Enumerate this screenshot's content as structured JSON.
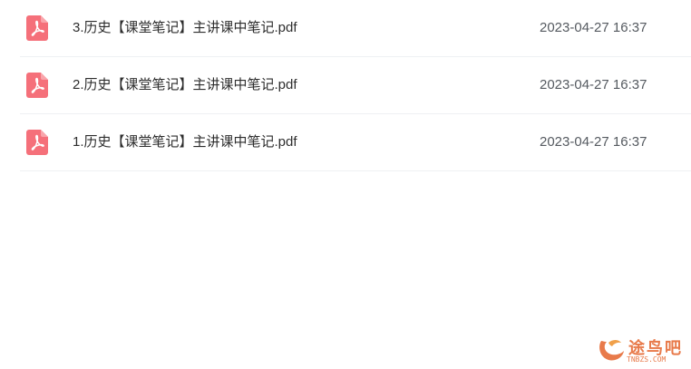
{
  "files": [
    {
      "name": "3.历史【课堂笔记】主讲课中笔记.pdf",
      "date": "2023-04-27 16:37",
      "icon": "pdf-file-icon"
    },
    {
      "name": "2.历史【课堂笔记】主讲课中笔记.pdf",
      "date": "2023-04-27 16:37",
      "icon": "pdf-file-icon"
    },
    {
      "name": "1.历史【课堂笔记】主讲课中笔记.pdf",
      "date": "2023-04-27 16:37",
      "icon": "pdf-file-icon"
    }
  ],
  "watermark": {
    "text": "途鸟吧",
    "sub": "TNBZS.COM"
  },
  "colors": {
    "pdf_icon": "#f5707a",
    "divider": "#eef0f3",
    "watermark": "#e87a4a"
  }
}
